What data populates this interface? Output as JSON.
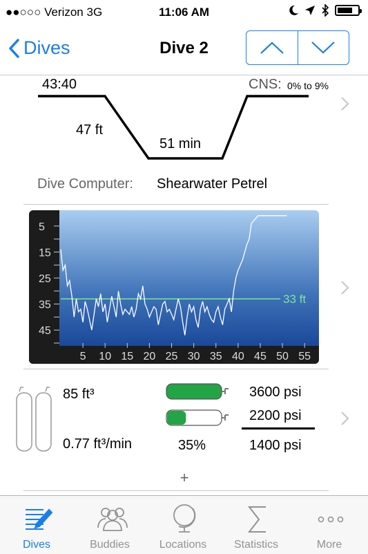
{
  "status": {
    "carrier": "●●○○○ Verizon   3G",
    "time": "11:06 AM"
  },
  "nav": {
    "back_label": "Dives",
    "title": "Dive 2"
  },
  "profile": {
    "time": "43:40",
    "cns_label": "CNS:",
    "cns_value": "0% to 9%",
    "depth": "47 ft",
    "duration": "51 min"
  },
  "computer": {
    "label": "Dive Computer:",
    "value": "Shearwater Petrel"
  },
  "chart_data": {
    "type": "line",
    "x_ticks": [
      "5",
      "10",
      "15",
      "20",
      "25",
      "30",
      "35",
      "40",
      "45",
      "50",
      "55"
    ],
    "y_ticks": [
      "5",
      "15",
      "25",
      "35",
      "45"
    ],
    "ylim": [
      50,
      0
    ],
    "xlim": [
      0,
      57
    ],
    "average_label": "33 ft",
    "average_depth": 33,
    "series": [
      {
        "x": [
          0,
          0.5,
          1,
          1.5,
          2,
          2.5,
          3,
          3.5,
          4,
          4.5,
          5,
          5.5,
          6,
          6.5,
          7,
          7.5,
          8,
          8.5,
          9,
          9.5,
          10,
          10.5,
          11,
          11.5,
          12,
          12.5,
          13,
          13.5,
          14,
          14.5,
          15,
          15.5,
          16,
          16.5,
          17,
          17.5,
          18,
          18.5,
          19,
          19.5,
          20,
          20.5,
          21,
          21.5,
          22,
          22.5,
          23,
          23.5,
          24,
          24.5,
          25,
          25.5,
          26,
          26.5,
          27,
          27.5,
          28,
          28.5,
          29,
          29.5,
          30,
          30.5,
          31,
          31.5,
          32,
          32.5,
          33,
          33.5,
          34,
          34.5,
          35,
          35.5,
          36,
          36.5,
          37,
          37.5,
          38,
          38.5,
          39,
          39.5,
          40,
          40.5,
          41,
          41.5,
          42,
          42.5,
          43,
          43.5,
          44,
          44.5,
          45,
          45.5,
          46,
          46.5,
          47,
          47.5,
          48,
          48.5,
          49,
          49.5,
          50,
          50.5,
          51
        ],
        "y": [
          14,
          22,
          20,
          28,
          26,
          32,
          40,
          33,
          38,
          37,
          42,
          34,
          37,
          41,
          45,
          39,
          33,
          36,
          31,
          38,
          35,
          42,
          37,
          32,
          36,
          40,
          30,
          35,
          39,
          37,
          38,
          39,
          36,
          40,
          37,
          31,
          33,
          28,
          35,
          37,
          40,
          38,
          36,
          37,
          43,
          39,
          35,
          34,
          38,
          37,
          39,
          41,
          37,
          33,
          36,
          42,
          47,
          40,
          35,
          38,
          36,
          41,
          44,
          37,
          34,
          38,
          36,
          39,
          41,
          42,
          38,
          36,
          40,
          43,
          37,
          35,
          33,
          38,
          30,
          25,
          22,
          20,
          18,
          15,
          12,
          10,
          4,
          3,
          2,
          1,
          1,
          1,
          1,
          1,
          1,
          1,
          1,
          1,
          1,
          1,
          1,
          1,
          1
        ]
      }
    ]
  },
  "tanks": {
    "volume": "85 ft³",
    "sac": "0.77 ft³/min",
    "percent": "35%",
    "start_pressure": "3600 psi",
    "end_pressure": "2200 psi",
    "used_pressure": "1400 psi",
    "fill_fraction": 0.35
  },
  "add_label": "+",
  "tabs": [
    {
      "label": "Dives",
      "icon": "dives-icon",
      "active": true
    },
    {
      "label": "Buddies",
      "icon": "buddies-icon",
      "active": false
    },
    {
      "label": "Locations",
      "icon": "globe-icon",
      "active": false
    },
    {
      "label": "Statistics",
      "icon": "sigma-icon",
      "active": false
    },
    {
      "label": "More",
      "icon": "more-icon",
      "active": false
    }
  ],
  "colors": {
    "accent": "#1a7ee9",
    "tank_green": "#22a447",
    "avg_line": "#7ee88f"
  }
}
